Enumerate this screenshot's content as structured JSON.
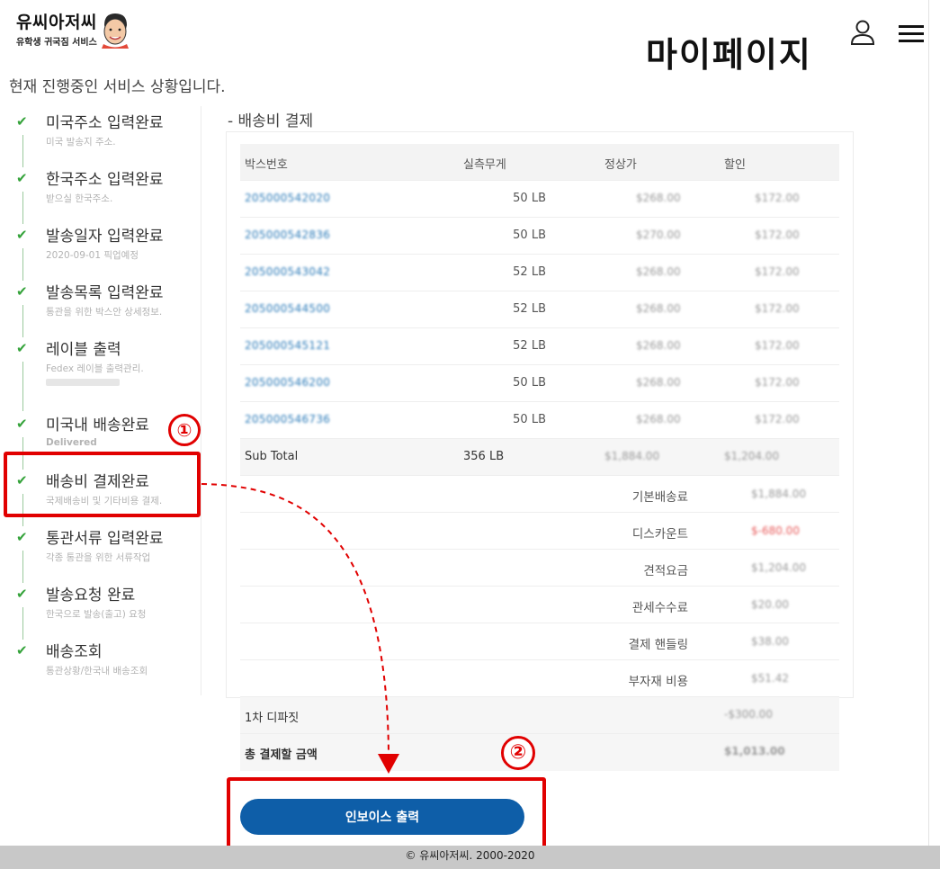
{
  "header": {
    "logo_main": "유씨아저씨",
    "logo_sub": "유학생 귀국짐 서비스",
    "page_title": "마이페이지"
  },
  "status_text": "현재 진행중인 서비스 상황입니다.",
  "steps": [
    {
      "title": "미국주소 입력완료",
      "sub": "미국 발송지 주소."
    },
    {
      "title": "한국주소 입력완료",
      "sub": "받으실 한국주소."
    },
    {
      "title": "발송일자 입력완료",
      "sub": "2020-09-01 픽업예정"
    },
    {
      "title": "발송목록 입력완료",
      "sub": "통관을 위한 박스안 상세정보."
    },
    {
      "title": "레이블 출력",
      "sub": "Fedex 레이블 출력관리."
    },
    {
      "title": "미국내 배송완료",
      "sub": "Delivered"
    },
    {
      "title": "배송비 결제완료",
      "sub": "국제배송비 및 기타비용 결제."
    },
    {
      "title": "통관서류 입력완료",
      "sub": "각종 통관을 위한 서류작업"
    },
    {
      "title": "발송요청 완료",
      "sub": "한국으로 발송(출고) 요청"
    },
    {
      "title": "배송조회",
      "sub": "통관상황/한국내 배송조회"
    }
  ],
  "annotations": {
    "one": "①",
    "two": "②"
  },
  "section_title": "- 배송비 결제",
  "table": {
    "headers": [
      "박스번호",
      "실측무게",
      "정상가",
      "할인"
    ],
    "rows": [
      {
        "box": "205000542020",
        "weight": "50 LB",
        "price": "$268.00",
        "discount": "$172.00"
      },
      {
        "box": "205000542836",
        "weight": "50 LB",
        "price": "$270.00",
        "discount": "$172.00"
      },
      {
        "box": "205000543042",
        "weight": "52 LB",
        "price": "$268.00",
        "discount": "$172.00"
      },
      {
        "box": "205000544500",
        "weight": "52 LB",
        "price": "$268.00",
        "discount": "$172.00"
      },
      {
        "box": "205000545121",
        "weight": "52 LB",
        "price": "$268.00",
        "discount": "$172.00"
      },
      {
        "box": "205000546200",
        "weight": "50 LB",
        "price": "$268.00",
        "discount": "$172.00"
      },
      {
        "box": "205000546736",
        "weight": "50 LB",
        "price": "$268.00",
        "discount": "$172.00"
      }
    ],
    "subtotal": {
      "label": "Sub Total",
      "weight": "356 LB",
      "price": "$1,884.00",
      "discount": "$1,204.00"
    },
    "fees": [
      {
        "label": "기본배송료",
        "value": "$1,884.00",
        "red": false
      },
      {
        "label": "디스카운트",
        "value": "$-680.00",
        "red": true
      },
      {
        "label": "견적요금",
        "value": "$1,204.00",
        "red": false
      },
      {
        "label": "관세수수료",
        "value": "$20.00",
        "red": false
      },
      {
        "label": "결제 핸들링",
        "value": "$38.00",
        "red": false
      },
      {
        "label": "부자재 비용",
        "value": "$51.42",
        "red": false
      }
    ],
    "deposit": {
      "label": "1차 디파짓",
      "value": "-$300.00"
    },
    "total": {
      "label": "총 결제할 금액",
      "value": "$1,013.00"
    }
  },
  "invoice_button": "인보이스 출력",
  "footer": "© 유씨아저씨. 2000-2020",
  "colors": {
    "accent": "#0e5ea8",
    "check": "#35a33b",
    "annotation": "#e10000"
  }
}
